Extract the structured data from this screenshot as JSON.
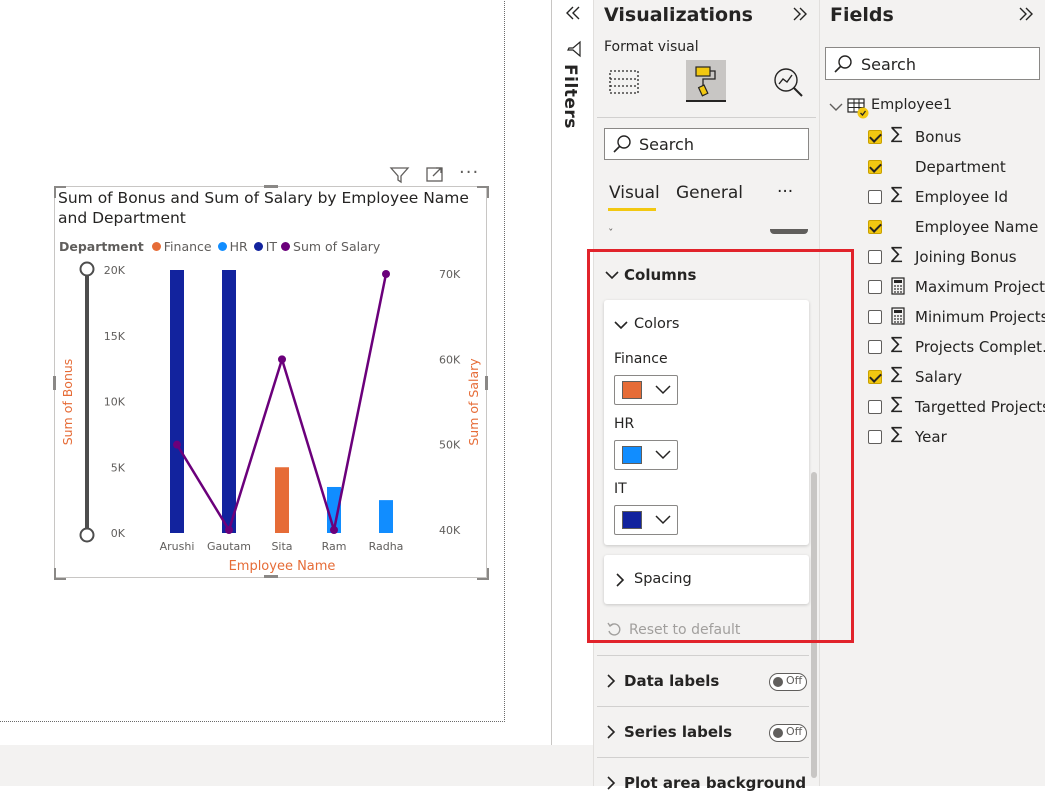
{
  "visual": {
    "title": "Sum of Bonus and Sum of Salary by Employee Name and Department",
    "legend": {
      "title": "Department",
      "items": [
        {
          "label": "Finance",
          "color": "#e66c37"
        },
        {
          "label": "HR",
          "color": "#118dff"
        },
        {
          "label": "IT",
          "color": "#12239e"
        },
        {
          "label": "Sum of Salary",
          "color": "#6b007b"
        }
      ]
    },
    "header_icons": [
      "filter-icon",
      "focus-mode-icon",
      "more-options-icon"
    ]
  },
  "chart_data": {
    "type": "bar",
    "title": "Sum of Bonus and Sum of Salary by Employee Name and Department",
    "xlabel": "Employee Name",
    "ylabel": "Sum of Bonus",
    "y2label": "Sum of Salary",
    "categories": [
      "Arushi",
      "Gautam",
      "Sita",
      "Ram",
      "Radha"
    ],
    "ylim": [
      0,
      20000
    ],
    "y2lim": [
      40000,
      70000
    ],
    "yticks": [
      "20K",
      "15K",
      "10K",
      "5K",
      "0K"
    ],
    "y2ticks": [
      "70K",
      "60K",
      "50K",
      "40K"
    ],
    "series": [
      {
        "name": "Finance",
        "color": "#e66c37",
        "values": [
          null,
          null,
          5000,
          null,
          null
        ]
      },
      {
        "name": "HR",
        "color": "#118dff",
        "values": [
          null,
          null,
          null,
          3500,
          2500
        ]
      },
      {
        "name": "IT",
        "color": "#12239e",
        "values": [
          20000,
          20000,
          null,
          null,
          null
        ]
      },
      {
        "name": "Sum of Salary",
        "type": "line",
        "axis": "secondary",
        "color": "#6b007b",
        "values": [
          50000,
          40000,
          60000,
          40000,
          70000
        ]
      }
    ],
    "legend_position": "top-left",
    "grid": false
  },
  "filters": {
    "label": "Filters"
  },
  "viz_pane": {
    "title": "Visualizations",
    "subtitle": "Format visual",
    "search_placeholder": "Search",
    "tabs": [
      "Visual",
      "General"
    ],
    "more": "···",
    "columns_section": "Columns",
    "colors_section": "Colors",
    "color_items": [
      {
        "label": "Finance",
        "color": "#e66c37"
      },
      {
        "label": "HR",
        "color": "#118dff"
      },
      {
        "label": "IT",
        "color": "#12239e"
      }
    ],
    "spacing_section": "Spacing",
    "reset_label": "Reset to default",
    "data_labels": "Data labels",
    "series_labels": "Series labels",
    "plot_area": "Plot area background",
    "toggle_off": "Off"
  },
  "fields_pane": {
    "title": "Fields",
    "search_placeholder": "Search",
    "table_name": "Employee1",
    "fields": [
      {
        "label": "Bonus",
        "checked": true,
        "icon": "sigma-icon"
      },
      {
        "label": "Department",
        "checked": true,
        "icon": ""
      },
      {
        "label": "Employee Id",
        "checked": false,
        "icon": "sigma-icon"
      },
      {
        "label": "Employee Name",
        "checked": true,
        "icon": ""
      },
      {
        "label": "Joining Bonus",
        "checked": false,
        "icon": "sigma-icon"
      },
      {
        "label": "Maximum Projects",
        "checked": false,
        "icon": "calculator-icon"
      },
      {
        "label": "Minimum Projects",
        "checked": false,
        "icon": "calculator-icon"
      },
      {
        "label": "Projects Complet…",
        "checked": false,
        "icon": "sigma-icon"
      },
      {
        "label": "Salary",
        "checked": true,
        "icon": "sigma-icon"
      },
      {
        "label": "Targetted Projects",
        "checked": false,
        "icon": "sigma-icon"
      },
      {
        "label": "Year",
        "checked": false,
        "icon": "sigma-icon"
      }
    ]
  }
}
